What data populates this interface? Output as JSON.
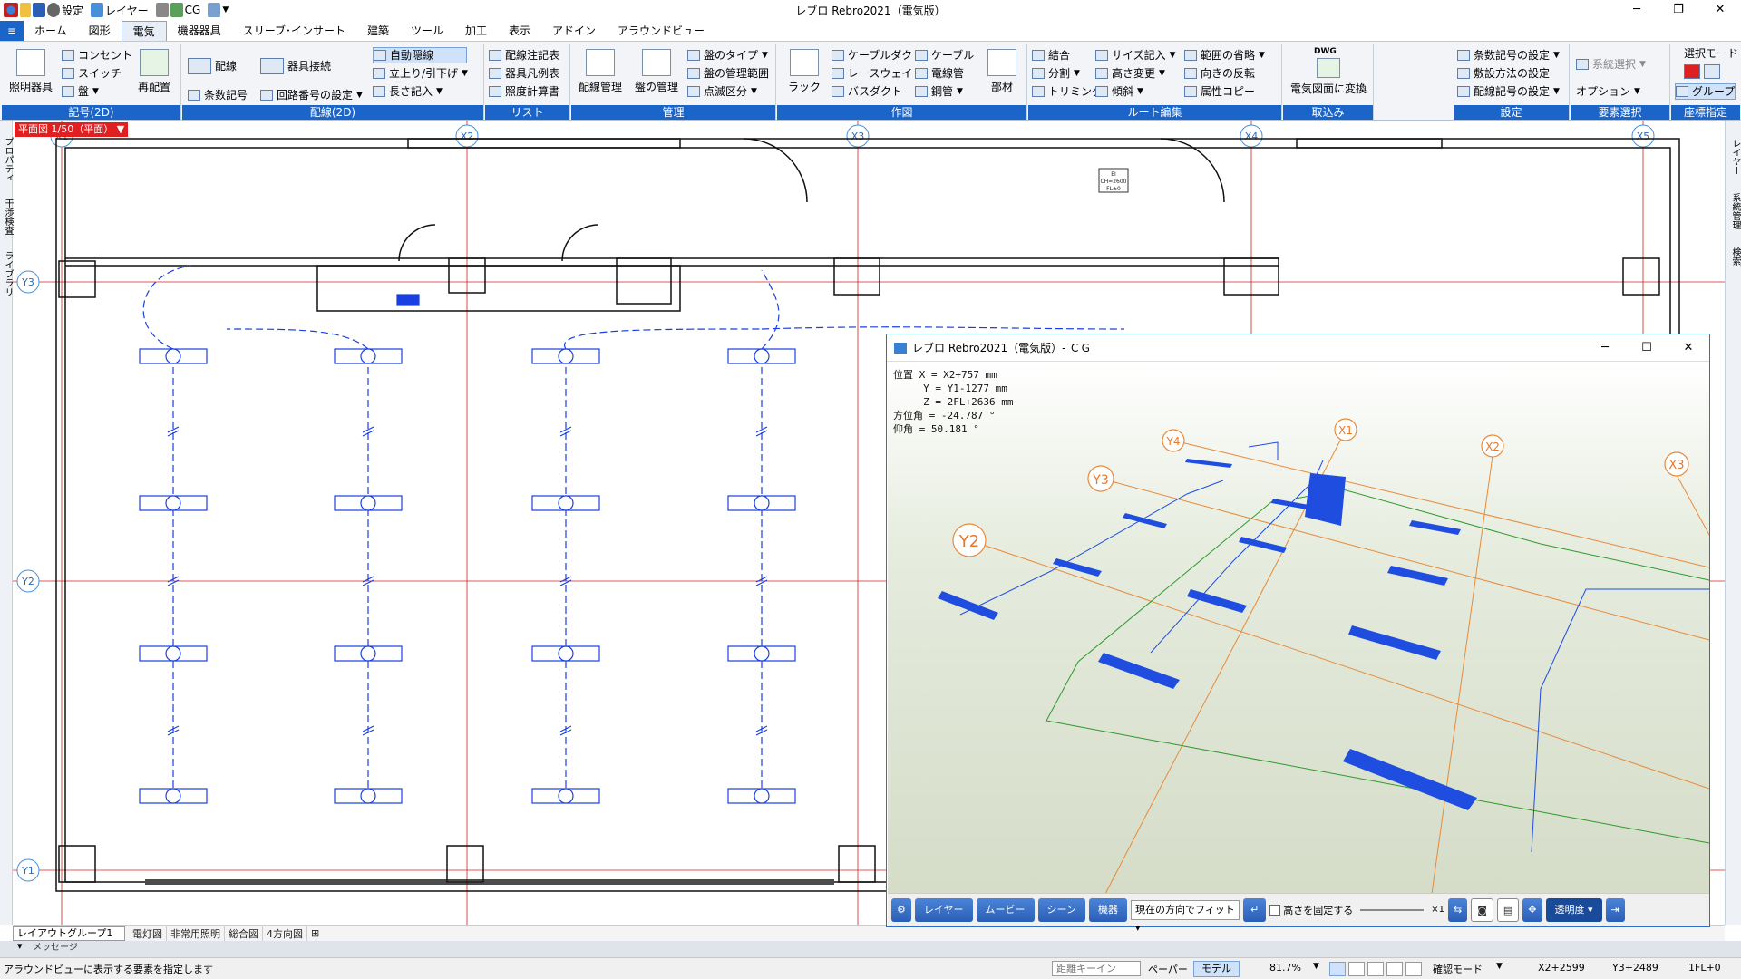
{
  "app": {
    "title": "レブロ Rebro2021（電気版）"
  },
  "quickaccess": {
    "settings": "設定",
    "layer": "レイヤー",
    "cg": "CG"
  },
  "tabs": [
    "ホーム",
    "図形",
    "電気",
    "機器器具",
    "スリーブ･インサート",
    "建築",
    "ツール",
    "加工",
    "表示",
    "アドイン",
    "アラウンドビュー"
  ],
  "ribbon": {
    "g_symbol": {
      "title": "記号(2D)",
      "lighting": "照明器具",
      "outlet": "コンセント",
      "switch": "スイッチ",
      "panel": "盤",
      "relayout": "再配置"
    },
    "g_wiring": {
      "title": "配線(2D)",
      "wiring": "配線",
      "fixture_conn": "器具接続",
      "auto_hidden": "自動隠線",
      "riser": "立上り/引下げ",
      "count_symbol": "条数記号",
      "circuit_set": "回路番号の設定",
      "length": "長さ記入"
    },
    "g_list": {
      "title": "リスト",
      "note_table": "配線注記表",
      "legend": "器具凡例表",
      "illum": "照度計算書"
    },
    "g_manage": {
      "title": "管理",
      "wiring_mgmt": "配線管理",
      "panel_mgmt": "盤の管理",
      "panel_type": "盤のタイプ",
      "panel_range": "盤の管理範囲",
      "blink": "点滅区分"
    },
    "g_draw": {
      "title": "作図",
      "rack": "ラック",
      "cable_duct": "ケーブルダクト",
      "raceway": "レースウェイ",
      "busduct": "バスダクト",
      "cable": "ケーブル",
      "wire_tube": "電線管",
      "conduit": "鋼管",
      "parts": "部材"
    },
    "g_route": {
      "title": "ルート編集",
      "join": "結合",
      "split": "分割",
      "trim": "トリミング",
      "size_input": "サイズ記入",
      "height_change": "高さ変更",
      "slope": "傾斜",
      "omit_range": "範囲の省略",
      "reverse": "向きの反転",
      "attr_copy": "属性コピー"
    },
    "g_import": {
      "title": "取込み",
      "dwg": "DWG",
      "convert": "電気図面に変換"
    },
    "g_setting": {
      "title": "設定",
      "count_set": "条数記号の設定",
      "install_set": "敷設方法の設定",
      "wiring_sym_set": "配線記号の設定"
    },
    "g_select": {
      "title": "要素選択",
      "system_select": "系統選択",
      "option": "オプション"
    },
    "g_coord": {
      "title": "座標指定",
      "select_mode": "選択モード",
      "group": "グループ"
    }
  },
  "view": {
    "label": "平面図 1/50（平面）"
  },
  "leftbar": [
    "プロパティ",
    "干渉検査",
    "ライブラリ"
  ],
  "rightbar": [
    "レイヤー",
    "系統管理",
    "検索"
  ],
  "grid": {
    "x": [
      "X1",
      "X2",
      "X3",
      "X4",
      "X5"
    ],
    "y": [
      "Y1",
      "Y2",
      "Y3"
    ]
  },
  "room_tag": {
    "line1": "EI",
    "line2": "CH=2600",
    "line3": "FL±0"
  },
  "cg": {
    "title": "レブロ Rebro2021（電気版）- ＣＧ",
    "readout": "位置 X = X2+757 mm\n     Y = Y1-1277 mm\n     Z = 2FL+2636 mm\n方位角 = -24.787 °\n仰角 = 50.181 °",
    "grid_labels": [
      "X1",
      "X2",
      "X3",
      "Y2",
      "Y3",
      "Y4"
    ],
    "toolbar": {
      "layer": "レイヤー",
      "movie": "ムービー",
      "scene": "シーン",
      "equip": "機器",
      "fit": "現在の方向でフィット",
      "fix_height": "高さを固定する",
      "scale": "×1",
      "transparency": "透明度"
    }
  },
  "layout": {
    "group": "レイアウトグループ1",
    "tabs": [
      "電灯図",
      "非常用照明",
      "総合図",
      "4方向図"
    ]
  },
  "message": {
    "label": "メッセージ",
    "text": "アラウンドビューに表示する要素を指定します"
  },
  "status": {
    "distance": "距離キーイン",
    "paper": "ペーパー",
    "model": "モデル",
    "zoom": "81.7%",
    "confirm_mode": "確認モード",
    "x": "X2+2599",
    "y": "Y3+2489",
    "floor": "1FL+0"
  },
  "colors": {
    "ribbon_title": "#1b64c8",
    "wiring": "#1a3fe0",
    "grid": "#d02020",
    "cg_grid": "#e88a3a",
    "cg_box": "#1e4de0"
  }
}
